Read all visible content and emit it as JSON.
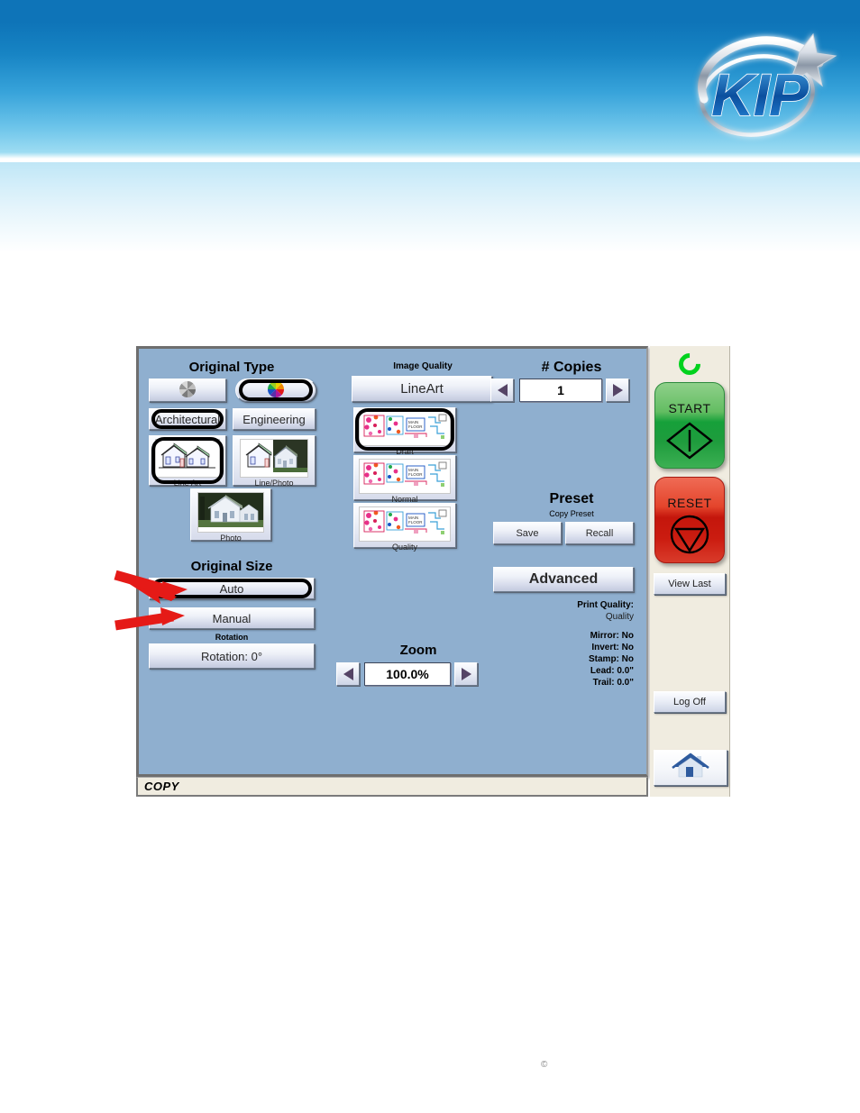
{
  "page": {
    "brand_logo": "kip-logo",
    "copyright_mark": "©",
    "accent_blue": "#0e74b8",
    "panel_blue": "#8fafcf",
    "side_beige": "#f0ece0"
  },
  "screen": {
    "status_bar_label": "COPY"
  },
  "original_type": {
    "title": "Original Type",
    "color_mode": [
      {
        "label": "",
        "icon": "grayscale-pinwheel-icon",
        "selected": false
      },
      {
        "label": "",
        "icon": "color-pinwheel-icon",
        "selected": true
      }
    ],
    "drawing_type": [
      {
        "label": "Architectural",
        "selected": true
      },
      {
        "label": "Engineering",
        "selected": false
      }
    ],
    "content_type": [
      {
        "label": "Line Art",
        "icon": "line-art-house-icon",
        "selected": true
      },
      {
        "label": "Line/Photo",
        "icon": "line-photo-house-icon",
        "selected": false
      },
      {
        "label": "Photo",
        "icon": "photo-house-icon",
        "selected": false
      }
    ]
  },
  "original_size": {
    "title": "Original Size",
    "options": [
      {
        "label": "Auto",
        "selected": true
      },
      {
        "label": "Manual",
        "selected": false
      }
    ],
    "rotation_title": "Rotation",
    "rotation_value": "Rotation: 0°"
  },
  "image_quality": {
    "title": "Image Quality",
    "mode_label": "LineArt",
    "levels": [
      {
        "label": "Draft",
        "selected": true
      },
      {
        "label": "Normal",
        "selected": false
      },
      {
        "label": "Quality",
        "selected": false
      }
    ]
  },
  "copies": {
    "title": "# Copies",
    "value": "1",
    "decrement_icon": "left-triangle-icon",
    "increment_icon": "right-triangle-icon"
  },
  "zoom": {
    "title": "Zoom",
    "value": "100.0%",
    "decrement_icon": "left-triangle-icon",
    "increment_icon": "right-triangle-icon"
  },
  "preset": {
    "title": "Preset",
    "subtitle": "Copy Preset",
    "save_label": "Save",
    "recall_label": "Recall"
  },
  "advanced": {
    "label": "Advanced"
  },
  "info_panel": {
    "print_quality_label": "Print Quality:",
    "print_quality_value": "Quality",
    "rows": [
      {
        "label": "Mirror: No"
      },
      {
        "label": "Invert: No"
      },
      {
        "label": "Stamp: No"
      },
      {
        "label": "Lead: 0.0\""
      },
      {
        "label": "Trail: 0.0\""
      }
    ]
  },
  "side_panel": {
    "status_icon": "ready-ring-icon",
    "start_label": "START",
    "start_icon": "diamond-bar-icon",
    "reset_label": "RESET",
    "reset_icon": "circle-triangle-icon",
    "view_last_label": "View Last",
    "log_off_label": "Log Off",
    "home_icon": "home-icon"
  },
  "annotations": {
    "arrow_color": "#e51a17",
    "arrows": [
      {
        "target": "Auto"
      },
      {
        "target": "Manual"
      }
    ]
  }
}
